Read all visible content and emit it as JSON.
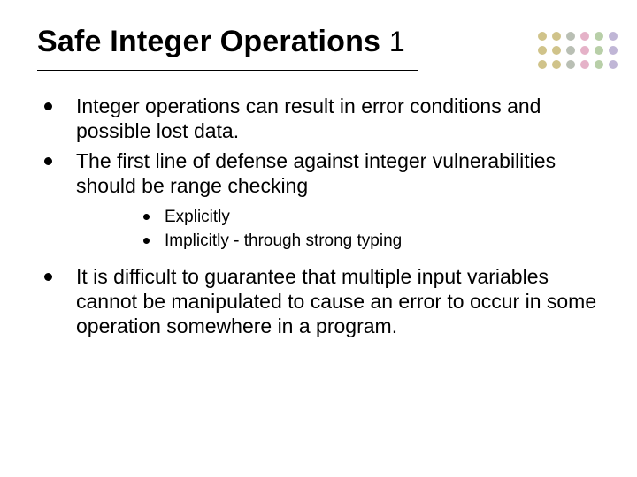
{
  "title": {
    "main": "Safe Integer Operations",
    "number": "1"
  },
  "bullets": [
    "Integer operations can result in error conditions and possible lost data.",
    "The first line of defense against integer vulnerabilities should be range checking"
  ],
  "sub_bullets": [
    "Explicitly",
    "Implicitly - through strong typing"
  ],
  "final_bullet": "It is difficult to guarantee that multiple input variables cannot be manipulated to cause an error to occur in some operation somewhere in a program."
}
